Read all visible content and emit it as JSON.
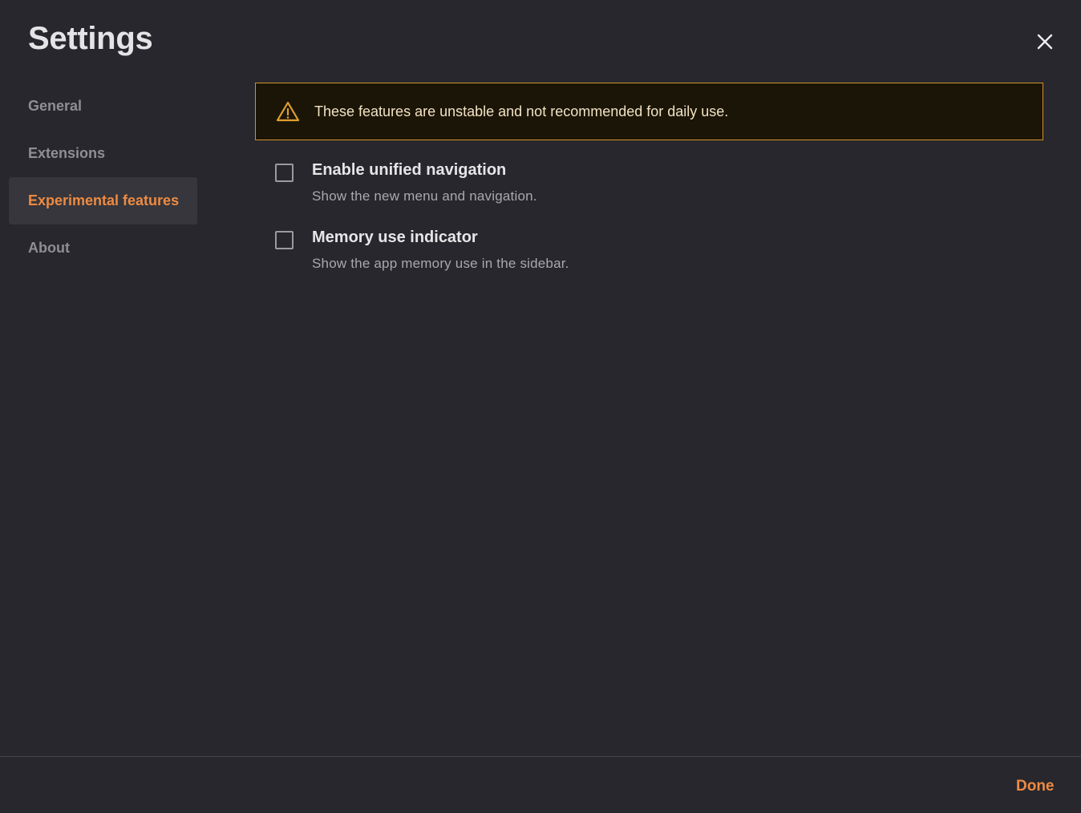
{
  "dialog": {
    "title": "Settings",
    "close_icon": "close-icon",
    "done_label": "Done"
  },
  "nav": {
    "items": [
      {
        "label": "General",
        "active": false
      },
      {
        "label": "Extensions",
        "active": false
      },
      {
        "label": "Experimental features",
        "active": true
      },
      {
        "label": "About",
        "active": false
      }
    ]
  },
  "warning": {
    "icon": "warning-triangle-icon",
    "text": "These features are unstable and not recommended for daily use."
  },
  "options": [
    {
      "label": "Enable unified navigation",
      "description": "Show the new menu and navigation.",
      "checked": false
    },
    {
      "label": "Memory use indicator",
      "description": "Show the app memory use in the sidebar.",
      "checked": false
    }
  ],
  "colors": {
    "background": "#27272d",
    "accent": "#ee8a42",
    "warning_border": "#d2922a",
    "warning_bg": "#1b1508",
    "nav_active_bg": "#36363c"
  }
}
